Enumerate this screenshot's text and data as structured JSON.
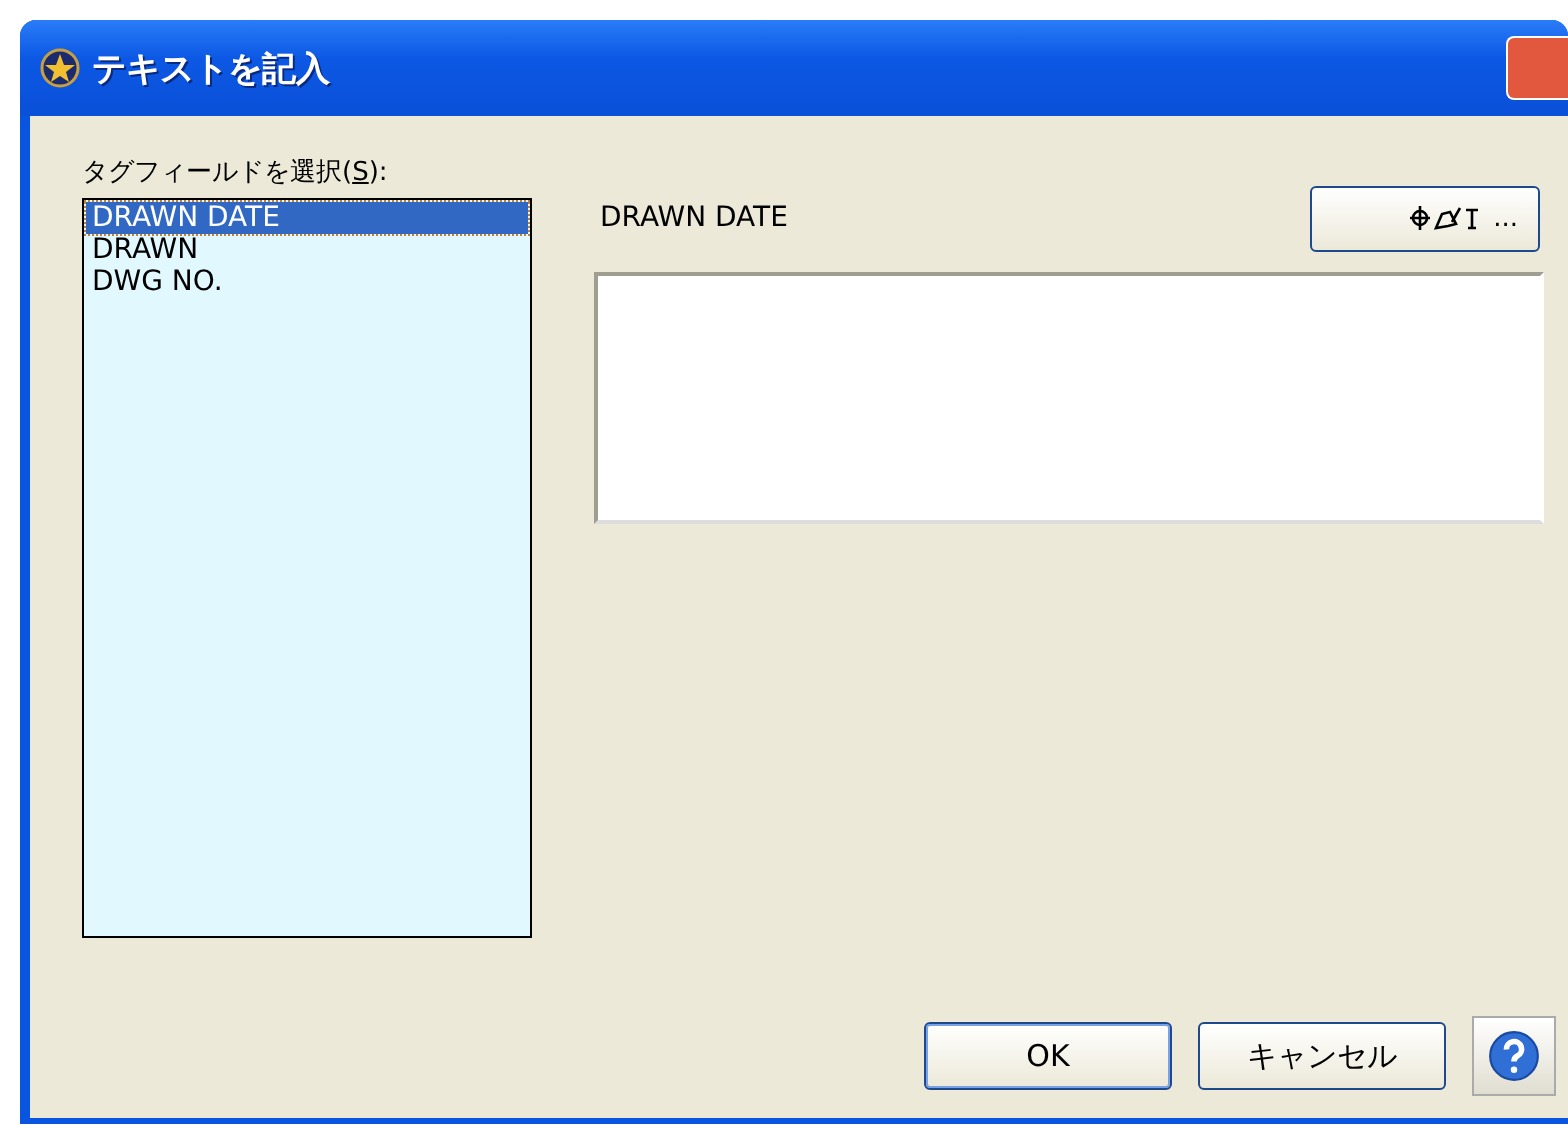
{
  "window": {
    "title": "テキストを記入"
  },
  "tag_list": {
    "label": {
      "before": "タグフィールドを選択(",
      "mnemonic": "S",
      "after": "):"
    },
    "items": [
      {
        "text": "DRAWN DATE",
        "selected": true
      },
      {
        "text": "DRAWN",
        "selected": false
      },
      {
        "text": "DWG NO.",
        "selected": false
      }
    ]
  },
  "field_name": "DRAWN DATE",
  "insert_button": {
    "text": "..."
  },
  "buttons": [
    {
      "kind": "ok",
      "text": "OK"
    },
    {
      "kind": "cancel",
      "text": "キャンセル"
    },
    {
      "kind": "help"
    }
  ]
}
